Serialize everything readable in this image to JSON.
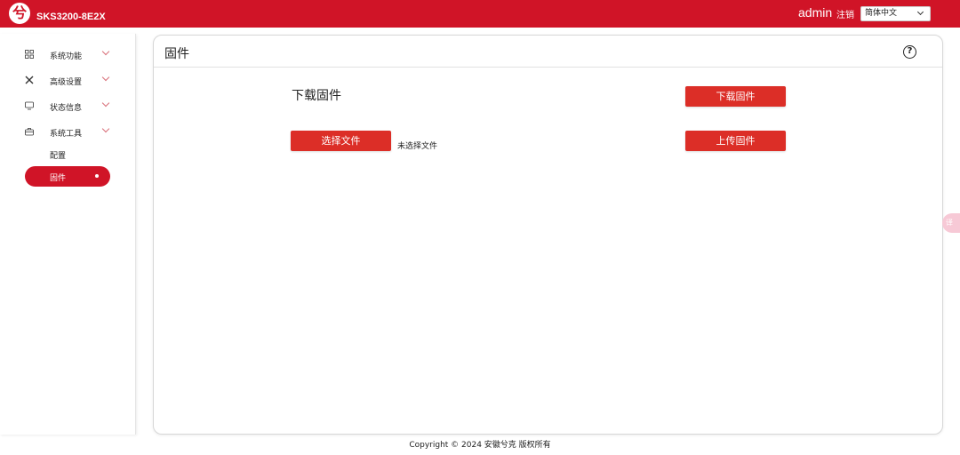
{
  "header": {
    "logo_char": "兮",
    "device_name": "SKS3200-8E2X",
    "user": "admin",
    "logout_label": "注销",
    "language": "简体中文"
  },
  "sidebar": {
    "items": [
      {
        "label": "系统功能",
        "icon": "grid-icon"
      },
      {
        "label": "高级设置",
        "icon": "tools-icon"
      },
      {
        "label": "状态信息",
        "icon": "monitor-icon"
      },
      {
        "label": "系统工具",
        "icon": "toolbox-icon"
      }
    ],
    "submenu": [
      {
        "label": "配置"
      },
      {
        "label": "固件",
        "active": true
      }
    ]
  },
  "panel": {
    "title": "固件",
    "help": "?",
    "download_section_label": "下载固件",
    "download_button": "下载固件",
    "choose_file_button": "选择文件",
    "file_status": "未选择文件",
    "upload_button": "上传固件"
  },
  "footer": {
    "copyright": "Copyright © 2024 安徽兮克 版权所有"
  },
  "floating": {
    "label": "译"
  },
  "colors": {
    "brand": "#d01427",
    "button": "#dc2e27",
    "float_tab": "#f7c9d6"
  }
}
